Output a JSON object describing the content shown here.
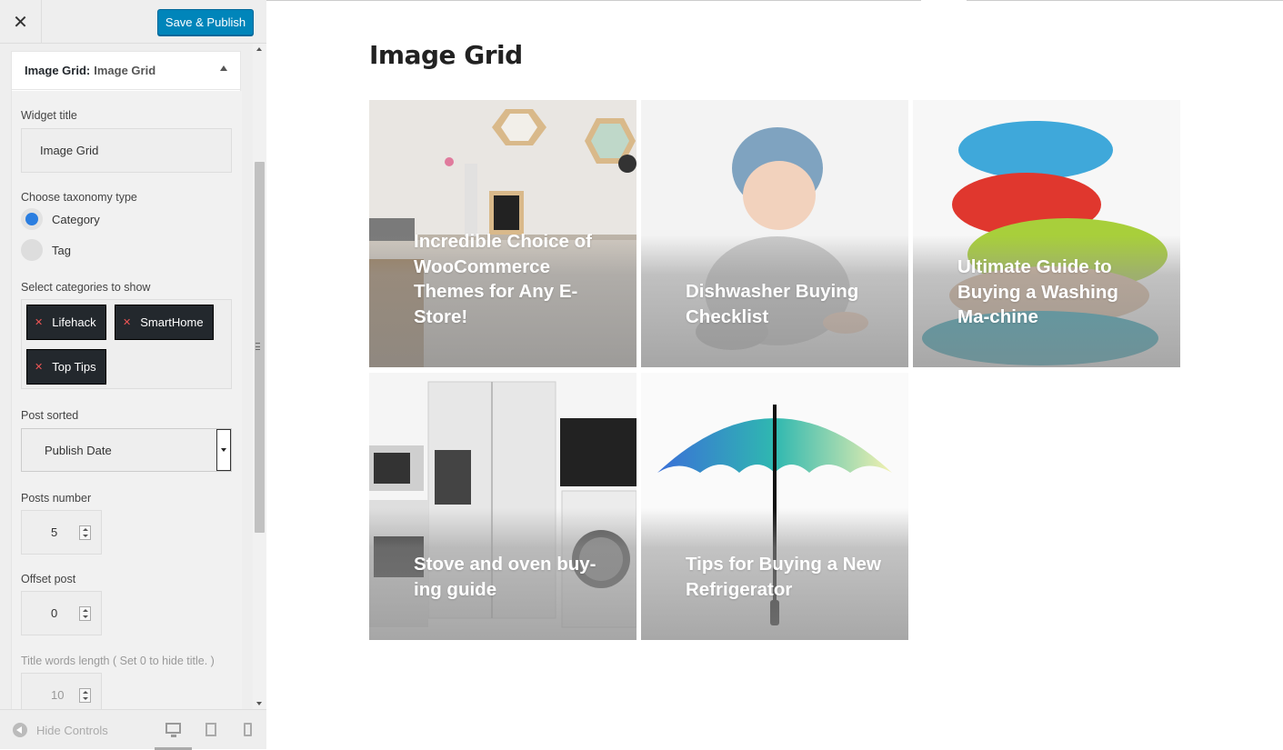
{
  "header": {
    "close_icon": "close-icon",
    "save_label": "Save & Publish"
  },
  "widget": {
    "title_prefix": "Image Grid:",
    "title_name": "Image Grid",
    "toggle_icon": "triangle-up-icon",
    "fields": {
      "widget_title_label": "Widget title",
      "widget_title_value": "Image Grid",
      "taxonomy_label": "Choose taxonomy type",
      "taxonomy_options": [
        {
          "label": "Category",
          "selected": true
        },
        {
          "label": "Tag",
          "selected": false
        }
      ],
      "categories_label": "Select categories to show",
      "categories": [
        "Lifehack",
        "SmartHome",
        "Top Tips"
      ],
      "post_sorted_label": "Post sorted",
      "post_sorted_value": "Publish Date",
      "posts_number_label": "Posts number",
      "posts_number_value": "5",
      "offset_label": "Offset post",
      "offset_value": "0",
      "title_words_label": "Title words length ( Set 0 to hide title. )",
      "title_words_value": "10"
    }
  },
  "footer": {
    "hide_controls_label": "Hide Controls",
    "devices": [
      "desktop-icon",
      "tablet-icon",
      "mobile-icon"
    ],
    "active_device": "desktop"
  },
  "preview": {
    "title": "Image Grid",
    "cards": [
      {
        "title": "Incredible Choice of WooCommerce Themes for Any E-Store!"
      },
      {
        "title": "Dishwasher Buying Checklist"
      },
      {
        "title": "Ultimate Guide to Buying a Washing Ma-chine"
      },
      {
        "title": "Stove and oven buy-ing guide"
      },
      {
        "title": "Tips for Buying a New Refrigerator"
      }
    ]
  },
  "colors": {
    "primary_button": "#0085ba",
    "chip_bg": "#23282d",
    "radio_selected": "#2b7ee0"
  }
}
